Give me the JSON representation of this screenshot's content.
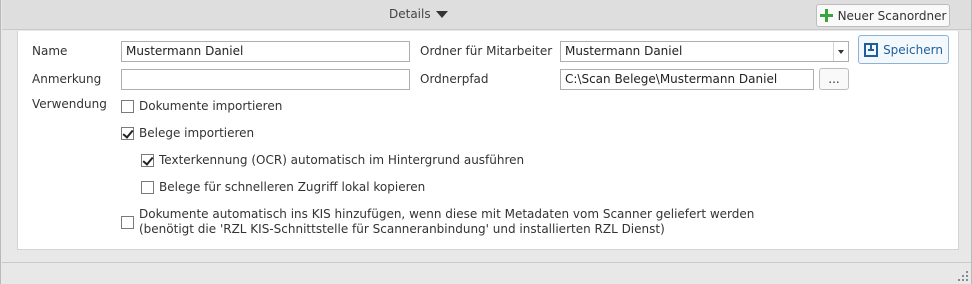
{
  "header": {
    "title": "Details",
    "new_button_label": "Neuer Scanordner"
  },
  "form": {
    "name_label": "Name",
    "name_value": "Mustermann Daniel",
    "remark_label": "Anmerkung",
    "remark_value": "",
    "usage_label": "Verwendung",
    "folder_label": "Ordner für Mitarbeiter",
    "folder_value": "Mustermann Daniel",
    "path_label": "Ordnerpfad",
    "path_value": "C:\\Scan Belege\\Mustermann Daniel",
    "browse_label": "...",
    "save_label": "Speichern"
  },
  "options": [
    {
      "label": "Dokumente importieren",
      "checked": false
    },
    {
      "label": "Belege importieren",
      "checked": true
    },
    {
      "label": "Texterkennung (OCR) automatisch im Hintergrund ausführen",
      "checked": true
    },
    {
      "label": "Belege für schnelleren Zugriff lokal kopieren",
      "checked": false
    },
    {
      "label_line1": "Dokumente automatisch ins KIS hinzufügen, wenn diese mit Metadaten vom Scanner geliefert werden",
      "label_line2": "(benötigt die 'RZL KIS-Schnittstelle für Scanneranbindung' und installierten RZL Dienst)",
      "checked": false
    }
  ],
  "colors": {
    "accent": "#1f5e9a",
    "plus_icon": "#3aa53a"
  },
  "icons": {
    "new": "plus-icon",
    "save": "save-icon",
    "dropdown": "caret-down-icon"
  }
}
